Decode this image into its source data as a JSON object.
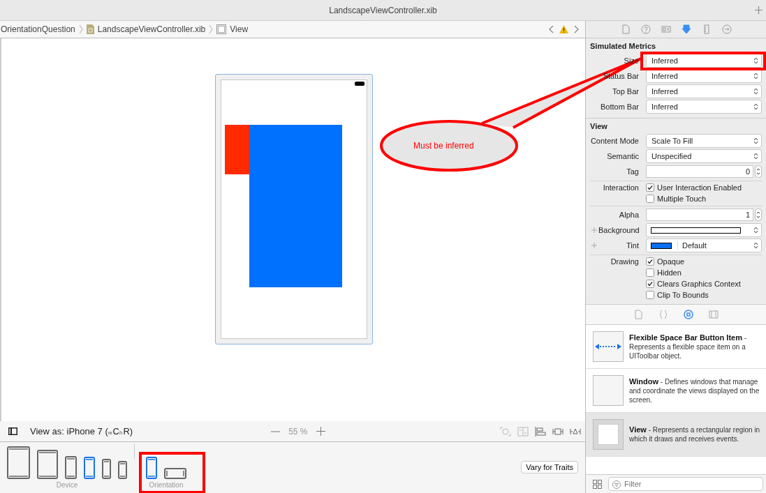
{
  "window": {
    "title": "LandscapeViewController.xib"
  },
  "breadcrumb": [
    {
      "text": "OrientationQuestion",
      "kind": "folder"
    },
    {
      "text": "LandscapeViewController.xib",
      "kind": "file"
    },
    {
      "text": "View",
      "kind": "view"
    }
  ],
  "annotation": {
    "text": "Must be inferred"
  },
  "canvas_toolbar": {
    "view_as": "View as: iPhone 7 (",
    "size_classes": [
      {
        "axis": "w",
        "value": "C"
      },
      {
        "axis": "h",
        "value": "R"
      }
    ],
    "close": ")",
    "zoom": "55 %"
  },
  "device_bar": {
    "devices": [
      {
        "kind": "ipad-large",
        "selected": false
      },
      {
        "kind": "ipad",
        "selected": false
      },
      {
        "kind": "phone-plus",
        "selected": false
      },
      {
        "kind": "phone",
        "selected": true
      },
      {
        "kind": "phone-se",
        "selected": false
      },
      {
        "kind": "phone-small",
        "selected": false
      }
    ],
    "device_label": "Device",
    "orientations": [
      {
        "kind": "portrait",
        "selected": true
      },
      {
        "kind": "landscape",
        "selected": false
      }
    ],
    "orientation_label": "Orientation",
    "vary_button": "Vary for Traits"
  },
  "inspector_tabs": [
    {
      "kind": "file",
      "selected": false
    },
    {
      "kind": "help",
      "selected": false
    },
    {
      "kind": "identity",
      "selected": false
    },
    {
      "kind": "attributes",
      "selected": true
    },
    {
      "kind": "size",
      "selected": false
    },
    {
      "kind": "connections",
      "selected": false
    }
  ],
  "sections": [
    {
      "title": "Simulated Metrics",
      "groups": [
        [
          {
            "kind": "popup",
            "label": "Size",
            "value": "Inferred"
          },
          {
            "kind": "popup",
            "label": "Status Bar",
            "value": "Inferred"
          },
          {
            "kind": "popup",
            "label": "Top Bar",
            "value": "Inferred"
          },
          {
            "kind": "popup",
            "label": "Bottom Bar",
            "value": "Inferred"
          }
        ]
      ]
    },
    {
      "title": "View",
      "groups": [
        [
          {
            "kind": "popup",
            "label": "Content Mode",
            "value": "Scale To Fill"
          },
          {
            "kind": "popup",
            "label": "Semantic",
            "value": "Unspecified"
          },
          {
            "kind": "stepper",
            "label": "Tag",
            "value": "0"
          }
        ],
        [
          {
            "kind": "checks",
            "label": "Interaction",
            "options": [
              {
                "label": "User Interaction Enabled",
                "checked": true
              },
              {
                "label": "Multiple Touch",
                "checked": false
              }
            ]
          }
        ],
        [
          {
            "kind": "stepper",
            "label": "Alpha",
            "value": "1"
          },
          {
            "kind": "color",
            "label": "Background",
            "color": "#ffffff"
          },
          {
            "kind": "color",
            "label": "Tint",
            "color": "#0a6ff0",
            "value": "Default"
          }
        ],
        [
          {
            "kind": "checks",
            "label": "Drawing",
            "options": [
              {
                "label": "Opaque",
                "checked": true
              },
              {
                "label": "Hidden",
                "checked": false
              },
              {
                "label": "Clears Graphics Context",
                "checked": true
              },
              {
                "label": "Clip To Bounds",
                "checked": false
              }
            ]
          }
        ]
      ]
    }
  ],
  "library_tabs": [
    {
      "kind": "file",
      "selected": false
    },
    {
      "kind": "code",
      "selected": false
    },
    {
      "kind": "object",
      "selected": true
    },
    {
      "kind": "media",
      "selected": false
    }
  ],
  "library": [
    {
      "kind": "flexible-space",
      "text": "**Flexible Space Bar Button Item** - Represents a flexible space item on a UIToolbar object.",
      "selected": false
    },
    {
      "kind": "window",
      "text": "**Window** - Defines windows that manage and coordinate the views displayed on the screen.",
      "selected": false
    },
    {
      "kind": "view",
      "text": "**View** - Represents a rectangular region in which it draws and receives events.",
      "selected": true
    }
  ],
  "filter": {
    "placeholder": "Filter"
  }
}
